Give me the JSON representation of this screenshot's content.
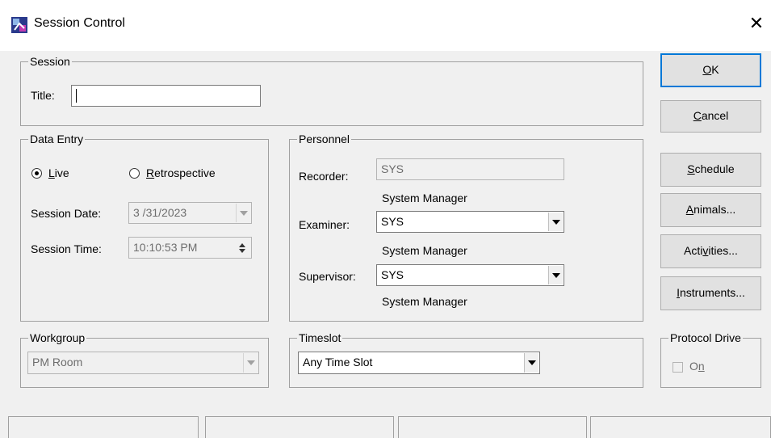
{
  "window": {
    "title": "Session Control",
    "close_glyph": "✕"
  },
  "session": {
    "legend": "Session",
    "title_label": "Title:",
    "title_value": ""
  },
  "data_entry": {
    "legend": "Data Entry",
    "live_label": "Live",
    "retrospective_label": "Retrospective",
    "selected_mode": "Live",
    "date_label": "Session Date:",
    "date_value": "3 /31/2023",
    "time_label": "Session Time:",
    "time_value": "10:10:53 PM"
  },
  "personnel": {
    "legend": "Personnel",
    "recorder_label": "Recorder:",
    "recorder_value": "SYS",
    "recorder_name": "System Manager",
    "examiner_label": "Examiner:",
    "examiner_value": "SYS",
    "examiner_name": "System Manager",
    "supervisor_label": "Supervisor:",
    "supervisor_value": "SYS",
    "supervisor_name": "System Manager"
  },
  "workgroup": {
    "legend": "Workgroup",
    "value": "PM Room"
  },
  "timeslot": {
    "legend": "Timeslot",
    "value": "Any Time Slot"
  },
  "protocol_drive": {
    "legend": "Protocol Drive",
    "on_label": "On",
    "checked": false
  },
  "buttons": {
    "ok": "OK",
    "cancel": "Cancel",
    "schedule": "Schedule",
    "animals": "Animals...",
    "activities": "Activities...",
    "instruments": "Instruments..."
  },
  "colors": {
    "focus_border": "#0078d7",
    "window_bg": "#f0f0f0",
    "disabled_text": "#6d6d6d"
  },
  "icons": {
    "app": "session-control-app-icon",
    "close": "close-icon",
    "dropdown": "chevron-down-icon",
    "spin": "spin-updown-icon"
  }
}
